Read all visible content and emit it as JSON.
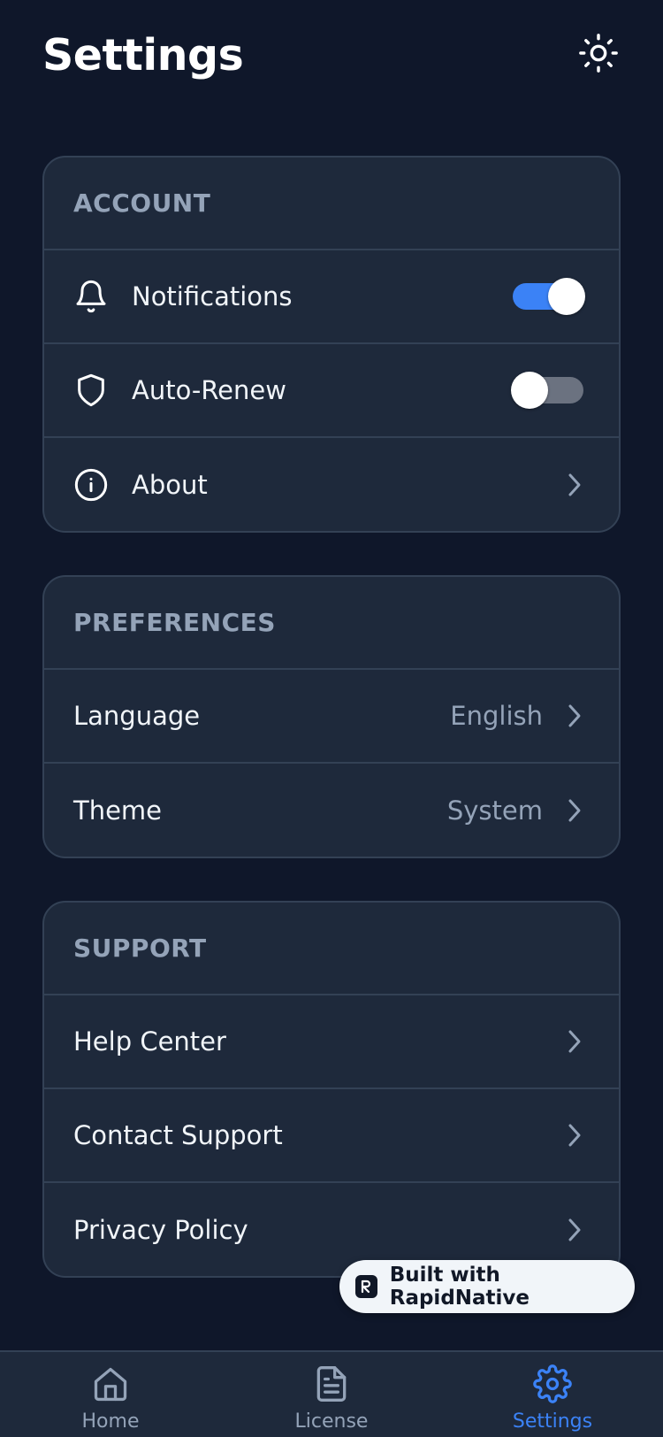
{
  "header": {
    "title": "Settings",
    "theme_icon": "sun-icon"
  },
  "sections": {
    "account": {
      "title": "ACCOUNT",
      "notifications": {
        "label": "Notifications",
        "icon": "bell-icon",
        "toggle": "on"
      },
      "auto_renew": {
        "label": "Auto-Renew",
        "icon": "shield-icon",
        "toggle": "off"
      },
      "about": {
        "label": "About",
        "icon": "info-icon"
      }
    },
    "preferences": {
      "title": "PREFERENCES",
      "language": {
        "label": "Language",
        "value": "English"
      },
      "theme": {
        "label": "Theme",
        "value": "System"
      }
    },
    "support": {
      "title": "SUPPORT",
      "help_center": {
        "label": "Help Center"
      },
      "contact_support": {
        "label": "Contact Support"
      },
      "privacy_policy": {
        "label": "Privacy Policy"
      }
    }
  },
  "badge": {
    "label": "Built with RapidNative"
  },
  "tabs": [
    {
      "label": "Home",
      "icon": "home-icon"
    },
    {
      "label": "License",
      "icon": "document-icon"
    },
    {
      "label": "Settings",
      "icon": "gear-icon",
      "active": true
    }
  ],
  "colors": {
    "background": "#0f172a",
    "card": "#1e293b",
    "border": "#334155",
    "accent": "#3b82f6",
    "muted": "#94a3b8",
    "toggle_off": "#6b7280"
  }
}
